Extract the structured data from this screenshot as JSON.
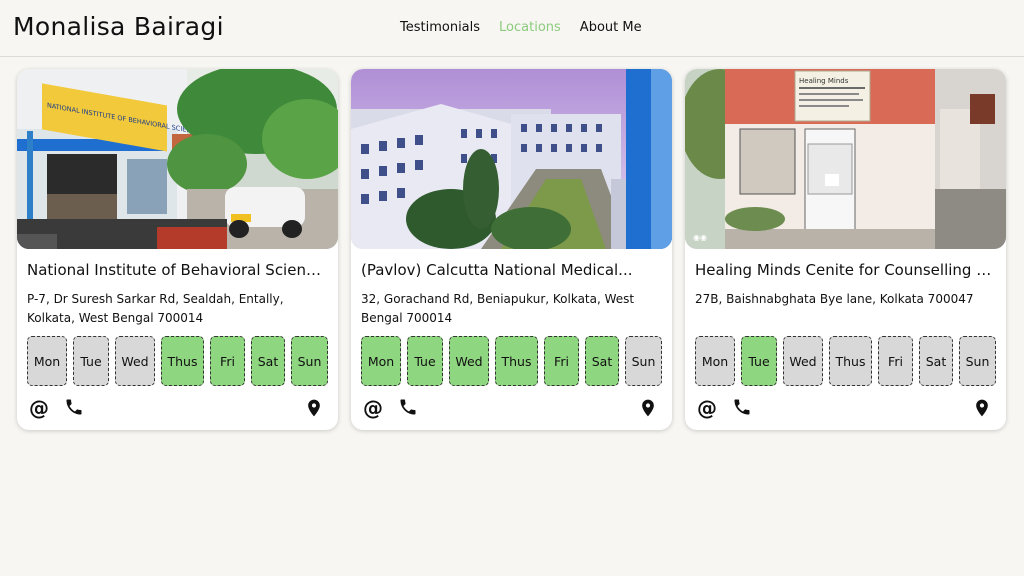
{
  "header": {
    "brand": "Monalisa Bairagi",
    "nav": [
      {
        "label": "Testimonials",
        "active": false
      },
      {
        "label": "Locations",
        "active": true
      },
      {
        "label": "About Me",
        "active": false
      }
    ]
  },
  "cards": [
    {
      "title": "National Institute of Behavioral Sciences",
      "address": "P-7, Dr Suresh Sarkar Rd, Sealdah, Entally, Kolkata, West Bengal 700014",
      "days": [
        {
          "label": "Mon",
          "open": false
        },
        {
          "label": "Tue",
          "open": false
        },
        {
          "label": "Wed",
          "open": false
        },
        {
          "label": "Thus",
          "open": true
        },
        {
          "label": "Fri",
          "open": true
        },
        {
          "label": "Sat",
          "open": true
        },
        {
          "label": "Sun",
          "open": true
        }
      ],
      "photo_signboard": "NATIONAL INSTITUTE OF BEHAVIORAL SCIENCES"
    },
    {
      "title": "(Pavlov) Calcutta National Medical...",
      "address": "32, Gorachand Rd, Beniapukur, Kolkata, West Bengal 700014",
      "days": [
        {
          "label": "Mon",
          "open": true
        },
        {
          "label": "Tue",
          "open": true
        },
        {
          "label": "Wed",
          "open": true
        },
        {
          "label": "Thus",
          "open": true
        },
        {
          "label": "Fri",
          "open": true
        },
        {
          "label": "Sat",
          "open": true
        },
        {
          "label": "Sun",
          "open": false
        }
      ]
    },
    {
      "title": "Healing Minds Cenite for Counselling an...",
      "address": "27B, Baishnabghata Bye lane, Kolkata 700047",
      "days": [
        {
          "label": "Mon",
          "open": false
        },
        {
          "label": "Tue",
          "open": true
        },
        {
          "label": "Wed",
          "open": false
        },
        {
          "label": "Thus",
          "open": false
        },
        {
          "label": "Fri",
          "open": false
        },
        {
          "label": "Sat",
          "open": false
        },
        {
          "label": "Sun",
          "open": false
        }
      ],
      "photo_signboard": "Healing Minds"
    }
  ],
  "icons": {
    "email": "at-icon",
    "phone": "phone-icon",
    "map": "map-pin-icon"
  },
  "colors": {
    "open_day": "#8fd680",
    "closed_day": "#d8d8d8",
    "nav_active": "#8ccc7e",
    "background": "#f7f6f2"
  }
}
